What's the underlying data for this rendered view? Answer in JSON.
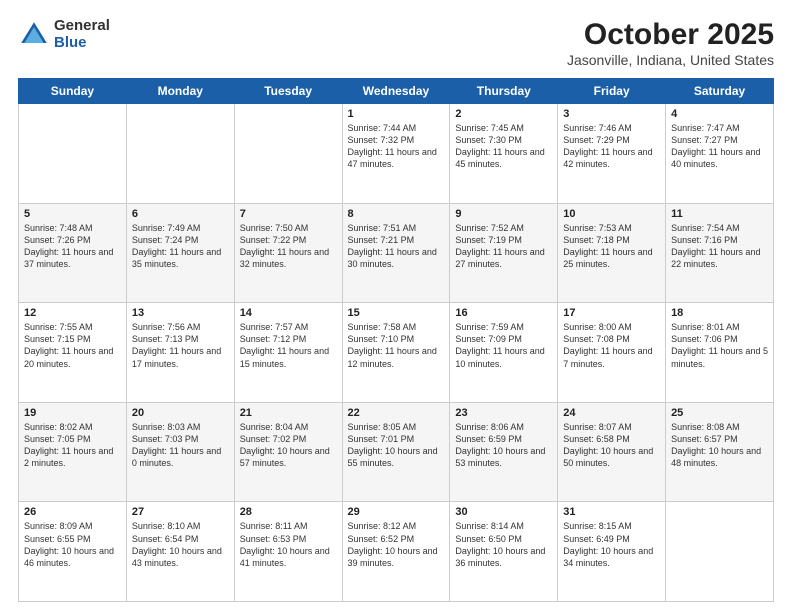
{
  "logo": {
    "general": "General",
    "blue": "Blue"
  },
  "title": "October 2025",
  "location": "Jasonville, Indiana, United States",
  "days": [
    "Sunday",
    "Monday",
    "Tuesday",
    "Wednesday",
    "Thursday",
    "Friday",
    "Saturday"
  ],
  "weeks": [
    [
      {
        "day": "",
        "text": ""
      },
      {
        "day": "",
        "text": ""
      },
      {
        "day": "",
        "text": ""
      },
      {
        "day": "1",
        "text": "Sunrise: 7:44 AM\nSunset: 7:32 PM\nDaylight: 11 hours and 47 minutes."
      },
      {
        "day": "2",
        "text": "Sunrise: 7:45 AM\nSunset: 7:30 PM\nDaylight: 11 hours and 45 minutes."
      },
      {
        "day": "3",
        "text": "Sunrise: 7:46 AM\nSunset: 7:29 PM\nDaylight: 11 hours and 42 minutes."
      },
      {
        "day": "4",
        "text": "Sunrise: 7:47 AM\nSunset: 7:27 PM\nDaylight: 11 hours and 40 minutes."
      }
    ],
    [
      {
        "day": "5",
        "text": "Sunrise: 7:48 AM\nSunset: 7:26 PM\nDaylight: 11 hours and 37 minutes."
      },
      {
        "day": "6",
        "text": "Sunrise: 7:49 AM\nSunset: 7:24 PM\nDaylight: 11 hours and 35 minutes."
      },
      {
        "day": "7",
        "text": "Sunrise: 7:50 AM\nSunset: 7:22 PM\nDaylight: 11 hours and 32 minutes."
      },
      {
        "day": "8",
        "text": "Sunrise: 7:51 AM\nSunset: 7:21 PM\nDaylight: 11 hours and 30 minutes."
      },
      {
        "day": "9",
        "text": "Sunrise: 7:52 AM\nSunset: 7:19 PM\nDaylight: 11 hours and 27 minutes."
      },
      {
        "day": "10",
        "text": "Sunrise: 7:53 AM\nSunset: 7:18 PM\nDaylight: 11 hours and 25 minutes."
      },
      {
        "day": "11",
        "text": "Sunrise: 7:54 AM\nSunset: 7:16 PM\nDaylight: 11 hours and 22 minutes."
      }
    ],
    [
      {
        "day": "12",
        "text": "Sunrise: 7:55 AM\nSunset: 7:15 PM\nDaylight: 11 hours and 20 minutes."
      },
      {
        "day": "13",
        "text": "Sunrise: 7:56 AM\nSunset: 7:13 PM\nDaylight: 11 hours and 17 minutes."
      },
      {
        "day": "14",
        "text": "Sunrise: 7:57 AM\nSunset: 7:12 PM\nDaylight: 11 hours and 15 minutes."
      },
      {
        "day": "15",
        "text": "Sunrise: 7:58 AM\nSunset: 7:10 PM\nDaylight: 11 hours and 12 minutes."
      },
      {
        "day": "16",
        "text": "Sunrise: 7:59 AM\nSunset: 7:09 PM\nDaylight: 11 hours and 10 minutes."
      },
      {
        "day": "17",
        "text": "Sunrise: 8:00 AM\nSunset: 7:08 PM\nDaylight: 11 hours and 7 minutes."
      },
      {
        "day": "18",
        "text": "Sunrise: 8:01 AM\nSunset: 7:06 PM\nDaylight: 11 hours and 5 minutes."
      }
    ],
    [
      {
        "day": "19",
        "text": "Sunrise: 8:02 AM\nSunset: 7:05 PM\nDaylight: 11 hours and 2 minutes."
      },
      {
        "day": "20",
        "text": "Sunrise: 8:03 AM\nSunset: 7:03 PM\nDaylight: 11 hours and 0 minutes."
      },
      {
        "day": "21",
        "text": "Sunrise: 8:04 AM\nSunset: 7:02 PM\nDaylight: 10 hours and 57 minutes."
      },
      {
        "day": "22",
        "text": "Sunrise: 8:05 AM\nSunset: 7:01 PM\nDaylight: 10 hours and 55 minutes."
      },
      {
        "day": "23",
        "text": "Sunrise: 8:06 AM\nSunset: 6:59 PM\nDaylight: 10 hours and 53 minutes."
      },
      {
        "day": "24",
        "text": "Sunrise: 8:07 AM\nSunset: 6:58 PM\nDaylight: 10 hours and 50 minutes."
      },
      {
        "day": "25",
        "text": "Sunrise: 8:08 AM\nSunset: 6:57 PM\nDaylight: 10 hours and 48 minutes."
      }
    ],
    [
      {
        "day": "26",
        "text": "Sunrise: 8:09 AM\nSunset: 6:55 PM\nDaylight: 10 hours and 46 minutes."
      },
      {
        "day": "27",
        "text": "Sunrise: 8:10 AM\nSunset: 6:54 PM\nDaylight: 10 hours and 43 minutes."
      },
      {
        "day": "28",
        "text": "Sunrise: 8:11 AM\nSunset: 6:53 PM\nDaylight: 10 hours and 41 minutes."
      },
      {
        "day": "29",
        "text": "Sunrise: 8:12 AM\nSunset: 6:52 PM\nDaylight: 10 hours and 39 minutes."
      },
      {
        "day": "30",
        "text": "Sunrise: 8:14 AM\nSunset: 6:50 PM\nDaylight: 10 hours and 36 minutes."
      },
      {
        "day": "31",
        "text": "Sunrise: 8:15 AM\nSunset: 6:49 PM\nDaylight: 10 hours and 34 minutes."
      },
      {
        "day": "",
        "text": ""
      }
    ]
  ]
}
